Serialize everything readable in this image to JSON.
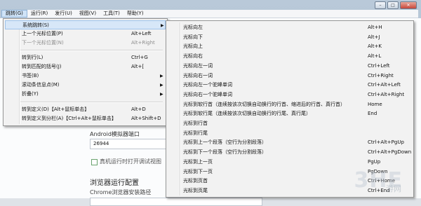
{
  "menubar": {
    "items": [
      {
        "label": "跳转(G)"
      },
      {
        "label": "运行(R)"
      },
      {
        "label": "发行(U)"
      },
      {
        "label": "视图(V)"
      },
      {
        "label": "工具(T)"
      },
      {
        "label": "帮助(Y)"
      }
    ]
  },
  "title_buttons": {
    "minimize": "–",
    "maximize": "□",
    "close": "✕"
  },
  "background_page": {
    "android_label": "Android模拟器端口",
    "android_port": "26944",
    "checkbox_label": "真机运行时打开调试视图",
    "browser_heading": "浏览器运行配置",
    "chrome_label": "Chrome浏览器安装路径"
  },
  "goto_menu": {
    "items": [
      {
        "label": "系统跳转(S)",
        "shortcut": "",
        "submenu": true
      },
      {
        "label": "上一个光标位置(P)",
        "shortcut": "Alt+Left"
      },
      {
        "label": "下一个光标位置(N)",
        "shortcut": "Alt+Right",
        "disabled": true
      },
      {
        "label": "转到行(L)",
        "shortcut": "Ctrl+G"
      },
      {
        "label": "转到匹配的括号(J)",
        "shortcut": "Alt+["
      },
      {
        "label": "书签(B)",
        "shortcut": "",
        "submenu": true
      },
      {
        "label": "滚动条信息点(M)",
        "shortcut": "",
        "submenu": true
      },
      {
        "label": "折叠(Y)",
        "shortcut": "",
        "submenu": true
      },
      {
        "label": "转到定义(D)【Alt+鼠标单击】",
        "shortcut": "Alt+D"
      },
      {
        "label": "转到定义到分栏(A)【Ctrl+Alt+鼠标单击】",
        "shortcut": "Alt+Shift+D"
      }
    ]
  },
  "system_jump_submenu": {
    "items": [
      {
        "label": "光标向左",
        "shortcut": "Alt+H"
      },
      {
        "label": "光标向下",
        "shortcut": "Alt+J"
      },
      {
        "label": "光标向上",
        "shortcut": "Alt+K"
      },
      {
        "label": "光标向右",
        "shortcut": "Alt+L"
      },
      {
        "label": "光标向左一词",
        "shortcut": "Ctrl+Left"
      },
      {
        "label": "光标向右一词",
        "shortcut": "Ctrl+Right"
      },
      {
        "label": "光标向左一个驼峰单词",
        "shortcut": "Ctrl+Alt+Left"
      },
      {
        "label": "光标向右一个驼峰单词",
        "shortcut": "Ctrl+Alt+Right"
      },
      {
        "label": "光标到软行首（连续按该次切换自动换行的行首、缩进后的行首、真行首）",
        "shortcut": "Home"
      },
      {
        "label": "光标到软行尾（连续按该次切换自动换行的行尾、真行尾）",
        "shortcut": "End"
      },
      {
        "label": "光标到行首",
        "shortcut": ""
      },
      {
        "label": "光标到行尾",
        "shortcut": ""
      },
      {
        "label": "光标到上一个段落（空行为分割段落）",
        "shortcut": "Ctrl+Alt+PgUp"
      },
      {
        "label": "光标到下一个段落（空行为分割段落）",
        "shortcut": "Ctrl+Alt+PgDown"
      },
      {
        "label": "光标到上一页",
        "shortcut": "PgUp"
      },
      {
        "label": "光标到下一页",
        "shortcut": "PgDown"
      },
      {
        "label": "光标到页首",
        "shortcut": "Ctrl+Home"
      },
      {
        "label": "光标到页尾",
        "shortcut": "Ctrl+End"
      }
    ]
  },
  "watermark": {
    "text": "3HE",
    "sub": "游网"
  }
}
